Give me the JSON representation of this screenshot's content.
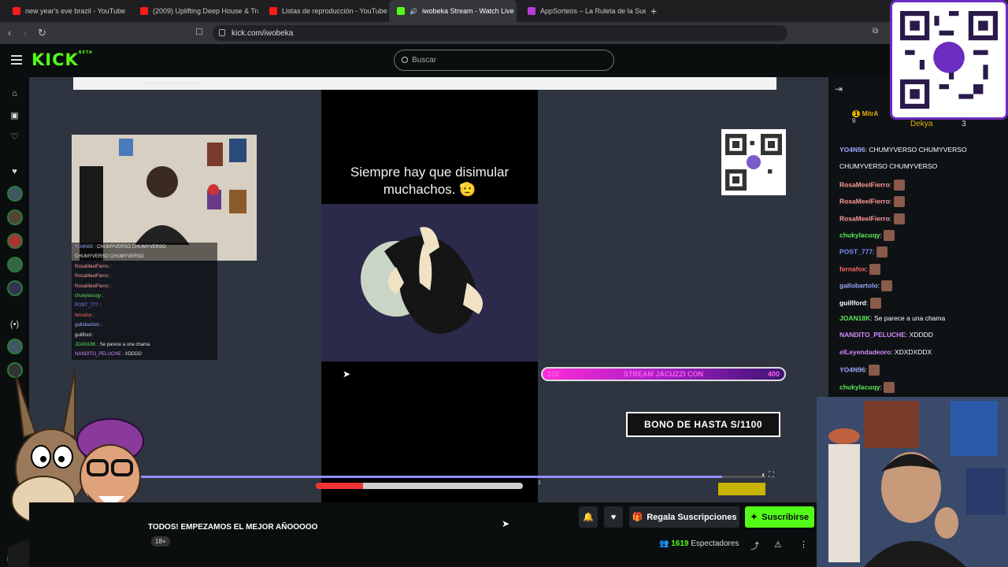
{
  "browser": {
    "tabs": [
      {
        "label": "new year's eve brazil - YouTube",
        "icon": "youtube-icon"
      },
      {
        "label": "(2009) Uplifting Deep House & Trance",
        "icon": "youtube-icon"
      },
      {
        "label": "Listas de reproducción - YouTube",
        "icon": "youtube-icon"
      },
      {
        "label": "iwobeka Stream - Watch Live",
        "icon": "kick-icon"
      },
      {
        "label": "AppSorteos – La Ruleta de la Suerte",
        "icon": "appsorteos-icon"
      }
    ],
    "url": "kick.com/iwobeka"
  },
  "header": {
    "logo": "KICK",
    "logo_badge": "BETA",
    "search_placeholder": "Buscar"
  },
  "video": {
    "overlay_text": "Siempre hay que disimular muchachos. 🫡",
    "overlay_chat": [
      {
        "user": "YO4N96",
        "text": "CHUMYVERSO  CHUMYVERSO"
      },
      {
        "user": "",
        "text": "CHUMYVERSO  CHUMYVERSO"
      },
      {
        "user": "RosaMeelFierro",
        "text": ""
      },
      {
        "user": "RosaMeelFierro",
        "text": ""
      },
      {
        "user": "RosaMeelFierro",
        "text": ""
      },
      {
        "user": "chukylacuqy",
        "text": ""
      },
      {
        "user": "POST_777",
        "text": ""
      },
      {
        "user": "fernafox",
        "text": ""
      },
      {
        "user": "gallobartolo",
        "text": ""
      },
      {
        "user": "guillford",
        "text": ""
      },
      {
        "user": "JOAN18K",
        "text": "Se parece a una chama"
      },
      {
        "user": "NANDITO_PELUCHE",
        "text": "XDDDD"
      }
    ],
    "jacuzzi_bar": {
      "left": "318",
      "text": "STREAM JACUZZI CON ",
      "right": "400"
    },
    "bono": "BONO DE HASTA S/1100",
    "page_number": "1"
  },
  "stream": {
    "title": "TODOS! EMPEZAMOS EL MEJOR AÑOOOOO",
    "age": "18+",
    "gift_button": "Regala Suscripciones",
    "subscribe_button": "Suscribirse",
    "viewers": "1619",
    "viewers_label": "Espectadores"
  },
  "chat": {
    "gifters": [
      {
        "name": "MitrA",
        "count": "9"
      },
      {
        "name": "Dekya",
        "count": "3"
      }
    ],
    "messages": [
      {
        "user": "YO4N96",
        "text": "CHUMYVERSO  CHUMYVERSO",
        "color": "#9aa7ff"
      },
      {
        "user": "",
        "text": "CHUMYVERSO  CHUMYVERSO",
        "color": "#ffffff"
      },
      {
        "user": "RosaMeelFierro",
        "text": "",
        "color": "#ff9a9a"
      },
      {
        "user": "RosaMeelFierro",
        "text": "",
        "color": "#ff9a9a"
      },
      {
        "user": "RosaMeelFierro",
        "text": "",
        "color": "#ff9a9a"
      },
      {
        "user": "chukylacuqy",
        "text": "",
        "color": "#5be85b"
      },
      {
        "user": "POST_777",
        "text": "",
        "color": "#7b8bff"
      },
      {
        "user": "fernafox",
        "text": "",
        "color": "#ff6666"
      },
      {
        "user": "gallobartolo",
        "text": "",
        "color": "#9aa7ff"
      },
      {
        "user": "guillford",
        "text": "",
        "color": "#ffffff"
      },
      {
        "user": "JOAN18K",
        "text": "Se parece a una chama",
        "color": "#5be85b"
      },
      {
        "user": "NANDITO_PELUCHE",
        "text": "XDDDD",
        "color": "#d38bff"
      },
      {
        "user": "elLeyendadeoro",
        "text": "XDXDXDDX",
        "color": "#d38bff"
      },
      {
        "user": "YO4N96",
        "text": "",
        "color": "#9aa7ff"
      },
      {
        "user": "chukylacuqy",
        "text": "",
        "color": "#5be85b"
      }
    ]
  },
  "colors": {
    "kick_green": "#53fc18",
    "yape_purple": "#6b2cbf"
  }
}
